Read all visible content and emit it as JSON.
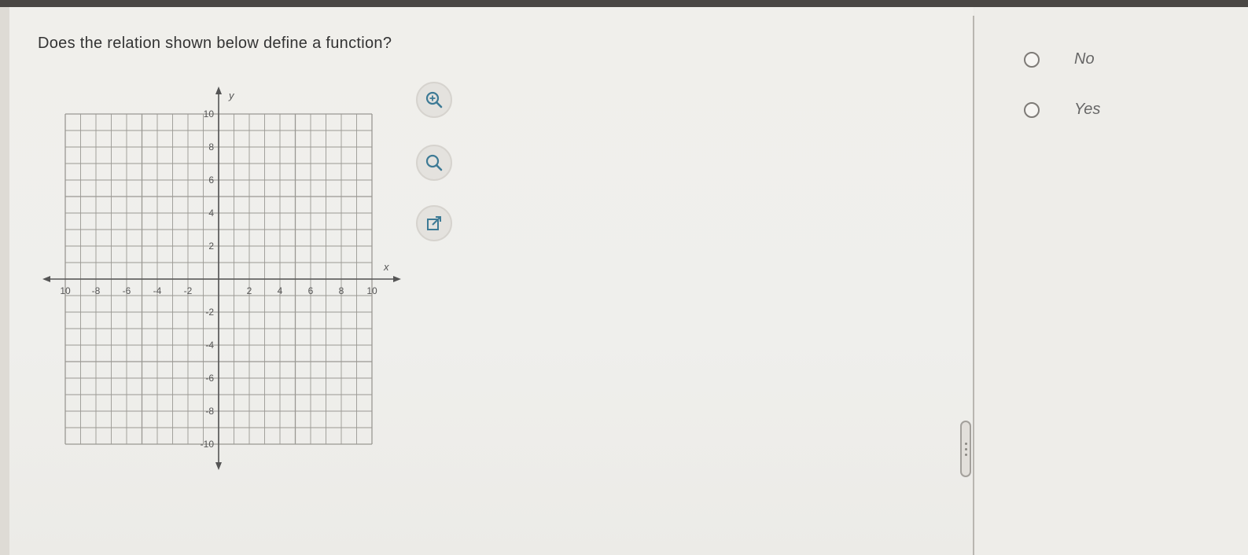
{
  "question": {
    "text": "Does the relation shown below define a function?"
  },
  "graph": {
    "x_axis_label": "x",
    "y_axis_label": "y",
    "x_ticks": [
      "10",
      "-8",
      "-6",
      "-4",
      "-2",
      "2",
      "4",
      "6",
      "8",
      "10"
    ],
    "y_ticks": [
      "10",
      "8",
      "6",
      "4",
      "2",
      "-2",
      "-4",
      "-6",
      "-8",
      "-10"
    ]
  },
  "tools": [
    {
      "icon": "zoom-in-icon"
    },
    {
      "icon": "zoom-out-icon"
    },
    {
      "icon": "open-external-icon"
    }
  ],
  "choices": [
    {
      "label": "No"
    },
    {
      "label": "Yes"
    }
  ]
}
